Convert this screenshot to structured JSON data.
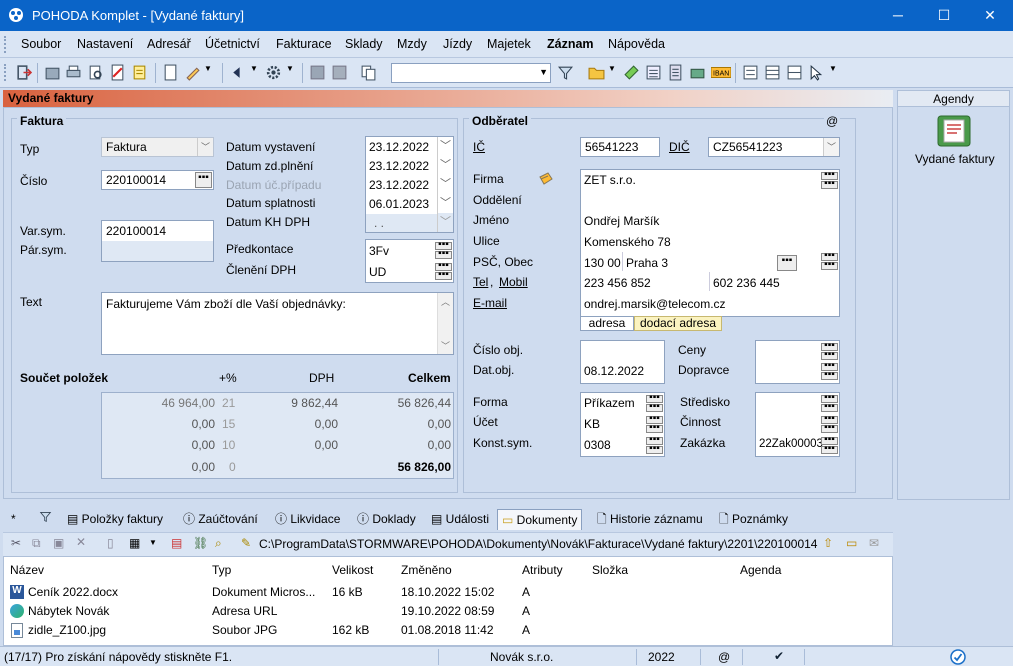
{
  "window": {
    "title": "POHODA Komplet - [Vydané faktury]",
    "minimize": "─",
    "maximize": "☐",
    "close": "✕"
  },
  "menu": [
    "Soubor",
    "Nastavení",
    "Adresář",
    "Účetnictví",
    "Fakturace",
    "Sklady",
    "Mzdy",
    "Jízdy",
    "Majetek",
    "Záznam",
    "Nápověda"
  ],
  "panel_title": "Vydané faktury",
  "faktura": {
    "section": "Faktura",
    "typ_label": "Typ",
    "typ_value": "Faktura",
    "cislo_label": "Číslo",
    "cislo_value": "220100014",
    "varsym_label": "Var.sym.",
    "varsym_value": "220100014",
    "parsym_label": "Pár.sym.",
    "text_label": "Text",
    "text_value": "Fakturujeme Vám zboží dle Vaší objednávky:",
    "dates": [
      {
        "label": "Datum vystavení",
        "value": "23.12.2022"
      },
      {
        "label": "Datum zd.plnění",
        "value": "23.12.2022"
      },
      {
        "label": "Datum úč.případu",
        "value": "23.12.2022"
      },
      {
        "label": "Datum splatnosti",
        "value": "06.01.2023"
      },
      {
        "label": "Datum KH DPH",
        "value": ". ."
      }
    ],
    "predkontace_label": "Předkontace",
    "predkontace_value": "3Fv",
    "cleneni_label": "Členění DPH",
    "cleneni_value": "UD"
  },
  "soucet": {
    "label": "Součet položek",
    "col_pct": "+%",
    "col_dph": "DPH",
    "col_celkem": "Celkem",
    "rows": [
      {
        "base": "46 964,00",
        "pct": "21",
        "dph": "9 862,44",
        "celkem": "56 826,44"
      },
      {
        "base": "0,00",
        "pct": "15",
        "dph": "0,00",
        "celkem": "0,00"
      },
      {
        "base": "0,00",
        "pct": "10",
        "dph": "0,00",
        "celkem": "0,00"
      },
      {
        "base": "0,00",
        "pct": "0",
        "dph": "",
        "celkem": "56 826,00"
      }
    ]
  },
  "odberatel": {
    "section": "Odběratel",
    "at": "@",
    "ic_label": "IČ",
    "ic_value": "56541223",
    "dic_label": "DIČ",
    "dic_value": "CZ56541223",
    "firma_label": "Firma",
    "firma_value": "ZET s.r.o.",
    "oddeleni_label": "Oddělení",
    "jmeno_label": "Jméno",
    "jmeno_value": "Ondřej Maršík",
    "ulice_label": "Ulice",
    "ulice_value": "Komenského 78",
    "psc_label": "PSČ, Obec",
    "psc_value": "130 00",
    "obec_value": "Praha 3",
    "tel_label": "Tel",
    "tel_sep": ",",
    "mobil_label": "Mobil",
    "tel_value": "223 456 852",
    "mobil_value": "602 236 445",
    "email_label": "E-mail",
    "email_value": "ondrej.marsik@telecom.cz",
    "tab_adresa": "adresa",
    "tab_dodaci": "dodací adresa"
  },
  "objednavka": {
    "cislo_label": "Číslo obj.",
    "dat_label": "Dat.obj.",
    "dat_value": "08.12.2022",
    "ceny_label": "Ceny",
    "dopravce_label": "Dopravce"
  },
  "platba": {
    "forma_label": "Forma",
    "forma_value": "Příkazem",
    "ucet_label": "Účet",
    "ucet_value": "KB",
    "konst_label": "Konst.sym.",
    "konst_value": "0308",
    "stredisko_label": "Středisko",
    "cinnost_label": "Činnost",
    "zakazka_label": "Zakázka",
    "zakazka_value": "22Zak00003"
  },
  "agenda": {
    "header": "Agendy",
    "item": "Vydané faktury"
  },
  "tabs": [
    "*",
    "",
    "Položky faktury",
    "Zaúčtování",
    "Likvidace",
    "Doklady",
    "Události",
    "Dokumenty",
    "Historie záznamu",
    "Poznámky"
  ],
  "docs": {
    "path": "C:\\ProgramData\\STORMWARE\\POHODA\\Dokumenty\\Novák\\Fakturace\\Vydané faktury\\2201\\220100014",
    "columns": [
      "Název",
      "Typ",
      "Velikost",
      "Změněno",
      "Atributy",
      "Složka",
      "Agenda"
    ],
    "rows": [
      {
        "name": "Ceník 2022.docx",
        "type": "Dokument Micros...",
        "size": "16 kB",
        "changed": "18.10.2022 15:02",
        "attr": "A"
      },
      {
        "name": "Nábytek Novák",
        "type": "Adresa URL",
        "size": "",
        "changed": "19.10.2022 08:59",
        "attr": "A"
      },
      {
        "name": "zidle_Z100.jpg",
        "type": "Soubor JPG",
        "size": "162 kB",
        "changed": "01.08.2018 11:42",
        "attr": "A"
      }
    ]
  },
  "status": {
    "help": "(17/17) Pro získání nápovědy stiskněte F1.",
    "company": "Novák s.r.o.",
    "year": "2022",
    "at": "@"
  },
  "colors": {
    "titlebar": "#0a64c8",
    "background": "#cfdcef",
    "panel_header": "#d9623f"
  }
}
